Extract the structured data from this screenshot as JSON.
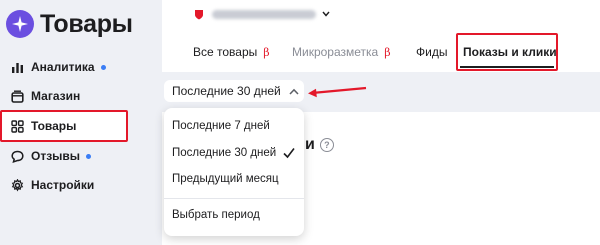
{
  "app": {
    "title": "Товары"
  },
  "sidebar": {
    "items": [
      {
        "label": "Аналитика",
        "icon": "bar-chart-icon",
        "dot": true
      },
      {
        "label": "Магазин",
        "icon": "store-icon",
        "dot": false
      },
      {
        "label": "Товары",
        "icon": "grid-icon",
        "dot": false,
        "active": true
      },
      {
        "label": "Отзывы",
        "icon": "chat-bubble-icon",
        "dot": true
      },
      {
        "label": "Настройки",
        "icon": "gear-icon",
        "dot": false
      }
    ]
  },
  "header": {
    "tabs": [
      {
        "label": "Все товары",
        "beta": "β"
      },
      {
        "label": "Микроразметка",
        "beta": "β",
        "muted": true
      },
      {
        "label": "Фиды"
      },
      {
        "label": "Показы и клики",
        "active": true
      }
    ]
  },
  "period": {
    "selected": "Последние 30 дней",
    "options": [
      "Последние 7 дней",
      "Последние 30 дней",
      "Предыдущий месяц"
    ],
    "custom": "Выбрать период"
  },
  "content": {
    "heading_fragment": "и",
    "help": "?"
  },
  "colors": {
    "accent": "#e3182a",
    "dot": "#3a7df5",
    "logo": "#6b4fe0"
  }
}
